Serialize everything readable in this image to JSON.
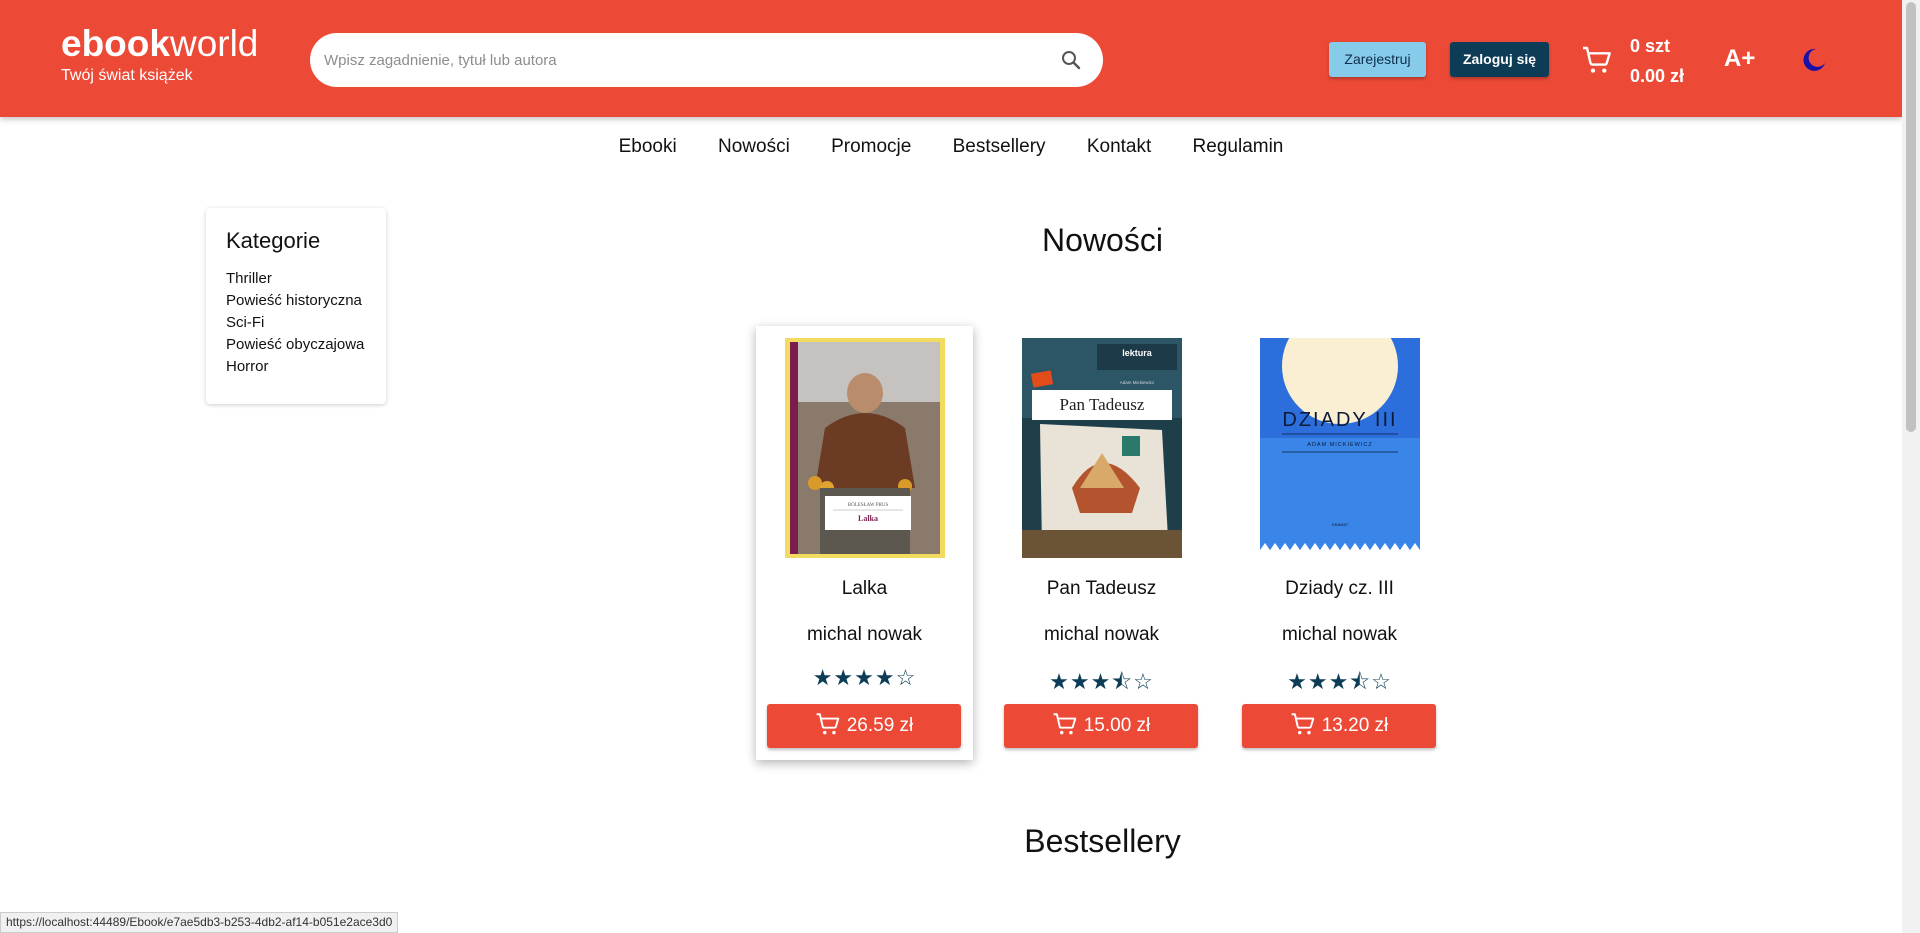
{
  "header": {
    "logo_bold": "ebook",
    "logo_light": "world",
    "tagline": "Twój świat książek",
    "search_placeholder": "Wpisz zagadnienie, tytuł lub autora",
    "register_label": "Zarejestruj",
    "login_label": "Zaloguj się",
    "cart_count": "0 szt",
    "cart_total": "0.00 zł",
    "font_size_label": "A+"
  },
  "nav": {
    "items": [
      "Ebooki",
      "Nowości",
      "Promocje",
      "Bestsellery",
      "Kontakt",
      "Regulamin"
    ]
  },
  "categories": {
    "title": "Kategorie",
    "items": [
      "Thriller",
      "Powieść historyczna",
      "Sci-Fi",
      "Powieść obyczajowa",
      "Horror"
    ]
  },
  "sections": {
    "new_title": "Nowości",
    "bestsellers_title": "Bestsellery"
  },
  "books": [
    {
      "title": "Lalka",
      "author": "michal nowak",
      "rating": 4,
      "rating_display": "★★★★☆",
      "price": "26.59 zł",
      "cover_title": "Lalka",
      "cover_author": "BOLESŁAW PRUS"
    },
    {
      "title": "Pan Tadeusz",
      "author": "michal nowak",
      "rating": 3.5,
      "rating_display": "★★★⯪☆",
      "price": "15.00 zł",
      "cover_title": "Pan Tadeusz",
      "cover_badge": "lektura",
      "cover_author": "Adam Mickiewicz"
    },
    {
      "title": "Dziady cz. III",
      "author": "michal nowak",
      "rating": 3.5,
      "rating_display": "★★★⯪☆",
      "price": "13.20 zł",
      "cover_title": "DZIADY III",
      "cover_author": "ADAM MICKIEWICZ",
      "cover_genre": "DRAMAT"
    }
  ],
  "status_url": "https://localhost:44489/Ebook/e7ae5db3-b253-4db2-af14-b051e2ace3d0",
  "colors": {
    "brand_red": "#ec4a37",
    "navy": "#0c3c56",
    "light_blue": "#87cbea",
    "moon": "#1a0fa8"
  }
}
